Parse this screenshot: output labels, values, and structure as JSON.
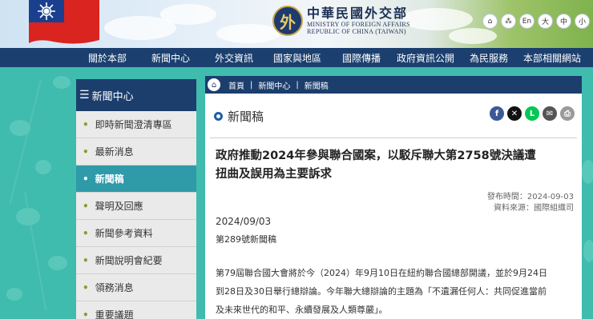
{
  "header": {
    "logo_zh": "中華民國外交部",
    "logo_en_1": "MINISTRY OF FOREIGN AFFAIRS",
    "logo_en_2": "REPUBLIC OF CHINA (TAIWAN)",
    "tools": [
      {
        "icon": "home-icon",
        "label": "⌂"
      },
      {
        "icon": "sitemap-icon",
        "label": "⁂"
      },
      {
        "icon": "language-en",
        "label": "En"
      },
      {
        "icon": "font-large",
        "label": "大"
      },
      {
        "icon": "font-medium",
        "label": "中"
      },
      {
        "icon": "font-small",
        "label": "小"
      }
    ]
  },
  "nav": [
    "關於本部",
    "新聞中心",
    "外交資訊",
    "國家與地區",
    "國際傳播",
    "政府資訊公開",
    "為民服務",
    "本部相關網站"
  ],
  "sidebar": {
    "title": "新聞中心",
    "items": [
      {
        "label": "即時新聞澄清專區",
        "active": false
      },
      {
        "label": "最新消息",
        "active": false
      },
      {
        "label": "新聞稿",
        "active": true
      },
      {
        "label": "聲明及回應",
        "active": false
      },
      {
        "label": "新聞參考資料",
        "active": false
      },
      {
        "label": "新聞說明會紀要",
        "active": false
      },
      {
        "label": "領務消息",
        "active": false
      },
      {
        "label": "重要議題",
        "active": false
      }
    ]
  },
  "breadcrumb": [
    "首頁",
    "新聞中心",
    "新聞稿"
  ],
  "page_title": "新聞稿",
  "share_buttons": [
    {
      "name": "facebook-icon",
      "glyph": "f",
      "color": "#3b5998"
    },
    {
      "name": "x-icon",
      "glyph": "✕",
      "color": "#111111"
    },
    {
      "name": "line-icon",
      "glyph": "L",
      "color": "#06c755"
    },
    {
      "name": "mail-icon",
      "glyph": "✉",
      "color": "#555555"
    },
    {
      "name": "print-icon",
      "glyph": "⎙",
      "color": "#9a9a9a"
    }
  ],
  "article": {
    "headline_1": "政府推動2024年參與聯合國案，以駁斥聯大第2758號決議遭",
    "headline_2": "扭曲及誤用為主要訴求",
    "publish_time": "發布時間：2024-09-03",
    "source": "資料來源：國際組織司",
    "date": "2024/09/03",
    "number": "第289號新聞稿",
    "paragraph": [
      "第79屆聯合國大會將於今（2024）年9月10日在紐約聯合國總部開議，並於9月24日",
      "到28日及30日舉行總辯論。今年聯大總辯論的主題為「不遺漏任何人：共同促進當前",
      "及未來世代的和平、永續發展及人類尊嚴」。"
    ]
  },
  "colors": {
    "nav": "#1b3f6e",
    "background": "#3fbcae",
    "active": "#2f9aa8"
  }
}
